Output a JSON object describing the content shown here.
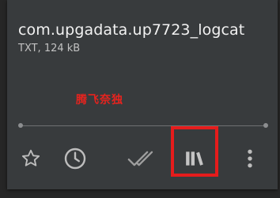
{
  "file": {
    "name": "com.upgadata.up7723_logcat",
    "meta": "TXT, 124 kB"
  },
  "watermark": "腾飞奈独",
  "progress": 0,
  "actions": [
    {
      "icon": "star-icon"
    },
    {
      "icon": "clock-icon"
    },
    {
      "icon": "double-check-icon"
    },
    {
      "icon": "library-books-icon"
    },
    {
      "icon": "more-vertical-icon"
    }
  ],
  "colors": {
    "background": "#262626",
    "card": "#383b3d",
    "highlight": "#e51c1c",
    "watermark": "#e8231e",
    "icon": "#bdbdbd"
  }
}
